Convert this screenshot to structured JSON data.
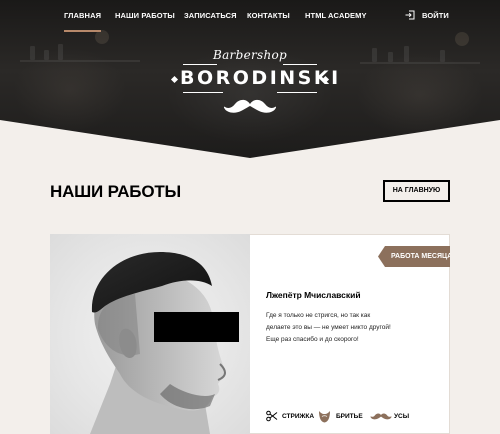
{
  "nav": {
    "items": [
      {
        "label": "ГЛАВНАЯ",
        "active": true
      },
      {
        "label": "НАШИ РАБОТЫ",
        "active": false
      },
      {
        "label": "ЗАПИСАТЬСЯ",
        "active": false
      },
      {
        "label": "КОНТАКТЫ",
        "active": false
      },
      {
        "label": "HTML ACADEMY",
        "active": false
      }
    ],
    "login_label": "ВОЙТИ",
    "login_icon": "login-icon"
  },
  "logo": {
    "script": "Barbershop",
    "main": "BORODINSKI",
    "icon": "mustache-icon"
  },
  "page": {
    "title": "НАШИ РАБОТЫ",
    "home_button": "НА ГЛАВНУЮ"
  },
  "work": {
    "badge": "РАБОТА МЕСЯЦА",
    "client": "Лжепётр Мчиславский",
    "review": "Где я только не стригся, но так как делаете это вы — не умеет никто другой! Еще раз спасибо и до скорого!",
    "services": [
      {
        "label": "СТРИЖКА",
        "icon": "scissors-icon"
      },
      {
        "label": "БРИТЬЕ",
        "icon": "beard-icon"
      },
      {
        "label": "УСЫ",
        "icon": "mustache-icon"
      }
    ]
  },
  "colors": {
    "accent": "#8c705c",
    "active_underline": "#b7896a",
    "background": "#f3efeb"
  }
}
